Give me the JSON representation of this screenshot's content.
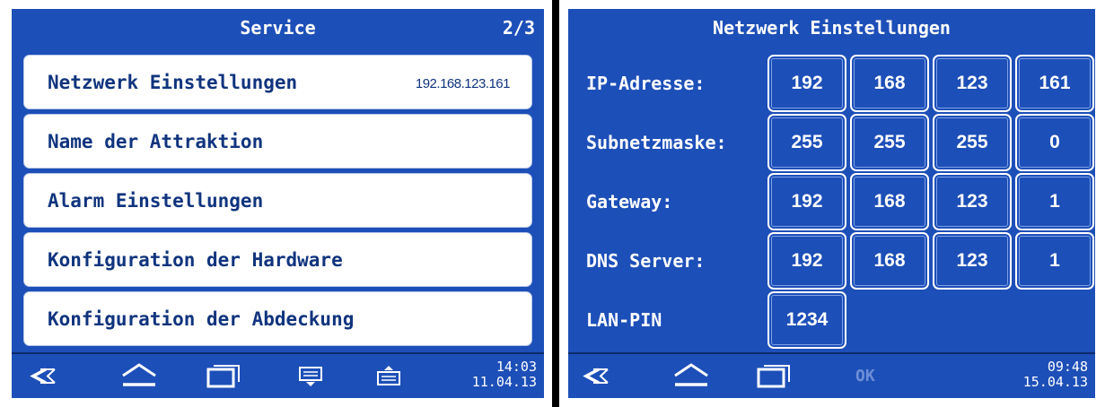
{
  "left_screen": {
    "header": {
      "title": "Service",
      "page": "2/3"
    },
    "menu": [
      {
        "label": "Netzwerk Einstellungen",
        "value": "192.168.123.161"
      },
      {
        "label": "Name der Attraktion"
      },
      {
        "label": "Alarm Einstellungen"
      },
      {
        "label": "Konfiguration der Hardware"
      },
      {
        "label": "Konfiguration der Abdeckung"
      }
    ],
    "nav": {
      "icons": [
        "back-icon",
        "home-icon",
        "windows-icon",
        "keyboard-down-icon",
        "keyboard-up-icon"
      ],
      "time": "14:03",
      "date": "11.04.13"
    }
  },
  "right_screen": {
    "header": {
      "title": "Netzwerk Einstellungen"
    },
    "rows": [
      {
        "label": "IP-Adresse:",
        "octets": [
          "192",
          "168",
          "123",
          "161"
        ]
      },
      {
        "label": "Subnetzmaske:",
        "octets": [
          "255",
          "255",
          "255",
          "0"
        ]
      },
      {
        "label": "Gateway:",
        "octets": [
          "192",
          "168",
          "123",
          "1"
        ]
      },
      {
        "label": "DNS Server:",
        "octets": [
          "192",
          "168",
          "123",
          "1"
        ]
      },
      {
        "label": "LAN-PIN",
        "octets": [
          "1234"
        ]
      }
    ],
    "nav": {
      "icons": [
        "back-icon",
        "home-icon",
        "windows-icon"
      ],
      "ok_label": "OK",
      "time": "09:48",
      "date": "15.04.13"
    }
  },
  "colors": {
    "panel_blue": "#1d4fb8",
    "text_dark_blue": "#10347e",
    "ok_disabled": "#6f8fd6"
  }
}
